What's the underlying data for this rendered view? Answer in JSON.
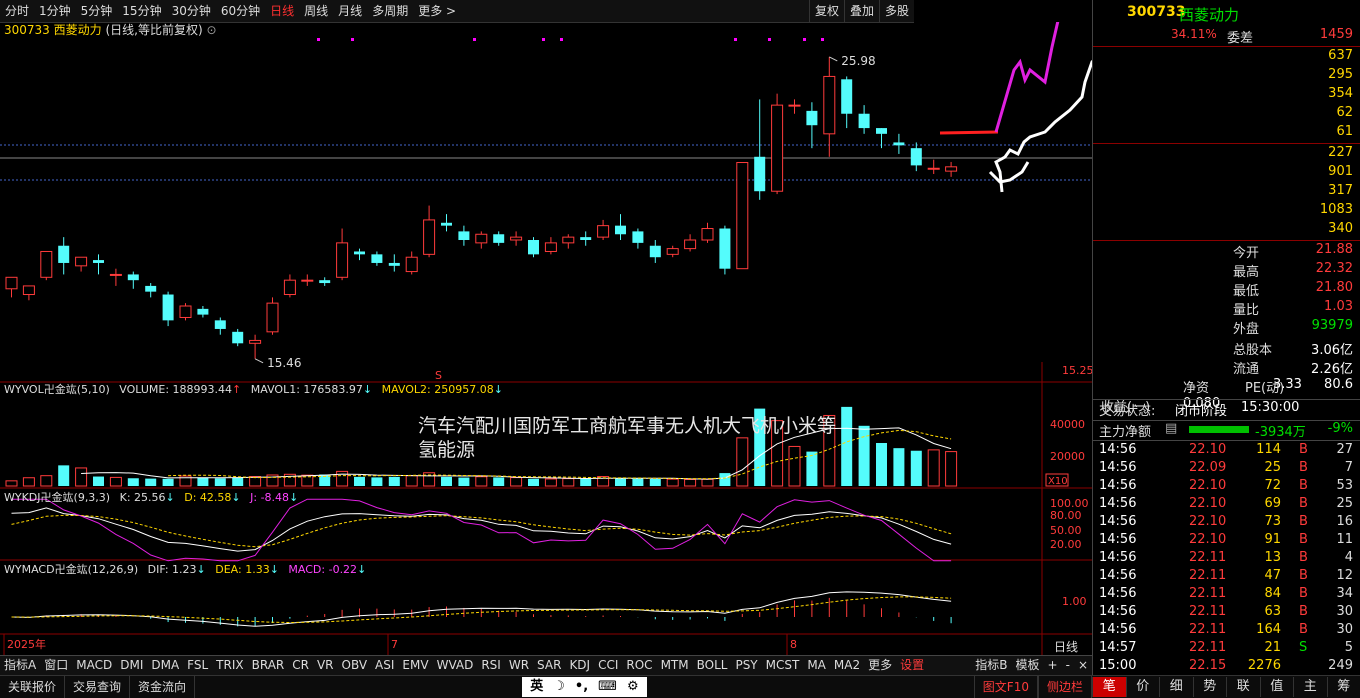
{
  "periods": [
    "分时",
    "1分钟",
    "5分钟",
    "15分钟",
    "30分钟",
    "60分钟",
    "日线",
    "周线",
    "月线",
    "多周期",
    "更多 >"
  ],
  "active_period": "日线",
  "tools": [
    "复权",
    "叠加",
    "多股"
  ],
  "stock": {
    "code": "300733",
    "name": "西菱动力",
    "mode": "(日线,等比前复权)"
  },
  "labels": {
    "high_price": "25.98",
    "low_price": "15.46"
  },
  "price_axis": {
    "top": "15.25"
  },
  "vol_axis": {
    "v1": "40000",
    "v2": "20000",
    "unit": "X10"
  },
  "kdj_axis": {
    "a": "100.00",
    "b": "80.00",
    "c": "50.00",
    "d": "20.00"
  },
  "macd_axis": {
    "a": "1.00"
  },
  "date_labels": [
    "2025年",
    "7",
    "8"
  ],
  "chart_tag": "日线",
  "vol_indicator": {
    "name": "WYVOL卍金竑(5,10)",
    "volume": "VOLUME: 188993.44",
    "mavol1": "MAVOL1: 176583.97",
    "mavol2": "MAVOL2: 250957.08"
  },
  "kdj_indicator": {
    "name": "WYKDJ卍金竑(9,3,3)",
    "k": "K: 25.56",
    "d": "D: 42.58",
    "j": "J: -8.48"
  },
  "macd_indicator": {
    "name": "WYMACD卍金竑(12,26,9)",
    "dif": "DIF: 1.23",
    "dea": "DEA: 1.33",
    "macd": "MACD: -0.22"
  },
  "overlay_text": {
    "line1": "汽车汽配川国防军工商航军事无人机大飞机小米等",
    "line2": "氢能源"
  },
  "indicator_tabs": [
    "指标A",
    "窗口",
    "MACD",
    "DMI",
    "DMA",
    "FSL",
    "TRIX",
    "BRAR",
    "CR",
    "VR",
    "OBV",
    "ASI",
    "EMV",
    "WVAD",
    "RSI",
    "WR",
    "SAR",
    "KDJ",
    "CCI",
    "ROC",
    "MTM",
    "BOLL",
    "PSY",
    "MCST",
    "MA",
    "MA2",
    "更多",
    "设置",
    "指标B",
    "模板",
    "+",
    "-",
    "×"
  ],
  "status_buttons": [
    "关联报价",
    "交易查询",
    "资金流向"
  ],
  "status_icons": [
    "英",
    "☽",
    "•,",
    "⌨",
    "⚙"
  ],
  "status_right": [
    "图文F10",
    "侧边栏"
  ],
  "panel": {
    "header_code": "300733",
    "header_name": "西菱动力",
    "wb_label": "委差",
    "wb_ratio": "34.11%",
    "wb_value": "1459",
    "book": [
      "637",
      "295",
      "354",
      "62",
      "61",
      "227",
      "901",
      "317",
      "1083",
      "340"
    ],
    "stats": [
      {
        "k": "今开",
        "v": "21.88"
      },
      {
        "k": "最高",
        "v": "22.32"
      },
      {
        "k": "最低",
        "v": "21.80"
      },
      {
        "k": "量比",
        "v": "1.03"
      },
      {
        "k": "外盘",
        "v": "93979"
      },
      {
        "k": "总股本",
        "v": "3.06亿"
      },
      {
        "k": "流通",
        "v": "2.26亿"
      },
      {
        "k": "净资",
        "v": "3.33"
      },
      {
        "k": "收益(一)",
        "v": "0.080"
      },
      {
        "k": "PE(动)",
        "v": "80.6"
      }
    ],
    "trade_state_label": "交易状态:",
    "trade_state": "闭市阶段",
    "trade_time": "15:30:00",
    "main_flow_label": "主力净额",
    "main_flow": "-3934万",
    "main_flow_pct": "-9%",
    "ticks": [
      {
        "t": "14:56",
        "p": "22.10",
        "v": "114",
        "d": "B",
        "n": "27"
      },
      {
        "t": "14:56",
        "p": "22.09",
        "v": "25",
        "d": "B",
        "n": "7"
      },
      {
        "t": "14:56",
        "p": "22.10",
        "v": "72",
        "d": "B",
        "n": "53"
      },
      {
        "t": "14:56",
        "p": "22.10",
        "v": "69",
        "d": "B",
        "n": "25"
      },
      {
        "t": "14:56",
        "p": "22.10",
        "v": "73",
        "d": "B",
        "n": "16"
      },
      {
        "t": "14:56",
        "p": "22.10",
        "v": "91",
        "d": "B",
        "n": "11"
      },
      {
        "t": "14:56",
        "p": "22.11",
        "v": "13",
        "d": "B",
        "n": "4"
      },
      {
        "t": "14:56",
        "p": "22.11",
        "v": "47",
        "d": "B",
        "n": "12"
      },
      {
        "t": "14:56",
        "p": "22.11",
        "v": "84",
        "d": "B",
        "n": "34"
      },
      {
        "t": "14:56",
        "p": "22.11",
        "v": "63",
        "d": "B",
        "n": "30"
      },
      {
        "t": "14:56",
        "p": "22.11",
        "v": "164",
        "d": "B",
        "n": "30"
      },
      {
        "t": "14:57",
        "p": "22.11",
        "v": "21",
        "d": "S",
        "n": "5"
      },
      {
        "t": "15:00",
        "p": "22.15",
        "v": "2276",
        "d": "",
        "n": "249"
      }
    ],
    "tabs": [
      "笔",
      "价",
      "细",
      "势",
      "联",
      "值",
      "主",
      "筹"
    ],
    "active_tab": "笔"
  },
  "chart_data": {
    "type": "candlestick",
    "candles": [
      [
        17.9,
        18.3,
        17.6,
        18.1
      ],
      [
        17.7,
        18.0,
        17.5,
        18.0
      ],
      [
        18.3,
        19.2,
        18.2,
        19.1
      ],
      [
        19.4,
        18.8,
        18.4,
        19.7
      ],
      [
        18.7,
        19.0,
        18.5,
        18.9
      ],
      [
        18.9,
        18.8,
        18.4,
        19.1
      ],
      [
        18.4,
        18.4,
        18.0,
        18.6
      ],
      [
        18.4,
        18.2,
        17.9,
        18.5
      ],
      [
        18.0,
        17.8,
        17.6,
        18.1
      ],
      [
        17.7,
        16.8,
        16.6,
        17.8
      ],
      [
        16.9,
        17.3,
        16.8,
        17.4
      ],
      [
        17.2,
        17.0,
        16.9,
        17.3
      ],
      [
        16.8,
        16.5,
        16.3,
        16.9
      ],
      [
        16.4,
        16.0,
        15.9,
        16.5
      ],
      [
        16.0,
        16.1,
        15.46,
        16.3
      ],
      [
        16.4,
        17.4,
        16.3,
        17.6
      ],
      [
        17.7,
        18.2,
        17.6,
        18.4
      ],
      [
        18.2,
        18.2,
        18.0,
        18.4
      ],
      [
        18.2,
        18.1,
        18.0,
        18.3
      ],
      [
        18.3,
        19.5,
        18.2,
        20.0
      ],
      [
        19.2,
        19.1,
        18.9,
        19.3
      ],
      [
        19.1,
        18.8,
        18.7,
        19.2
      ],
      [
        18.8,
        18.7,
        18.5,
        19.1
      ],
      [
        18.5,
        19.0,
        18.4,
        19.2
      ],
      [
        19.1,
        20.3,
        19.0,
        20.8
      ],
      [
        20.2,
        20.1,
        19.9,
        20.5
      ],
      [
        19.9,
        19.6,
        19.4,
        20.1
      ],
      [
        19.5,
        19.8,
        19.3,
        19.9
      ],
      [
        19.8,
        19.5,
        19.4,
        19.9
      ],
      [
        19.6,
        19.7,
        19.4,
        19.9
      ],
      [
        19.6,
        19.1,
        19.0,
        19.7
      ],
      [
        19.2,
        19.5,
        19.1,
        19.7
      ],
      [
        19.5,
        19.7,
        19.3,
        19.8
      ],
      [
        19.7,
        19.6,
        19.4,
        19.9
      ],
      [
        19.7,
        20.1,
        19.6,
        20.3
      ],
      [
        20.1,
        19.8,
        19.6,
        20.5
      ],
      [
        19.9,
        19.5,
        19.3,
        20.0
      ],
      [
        19.4,
        19.0,
        18.8,
        19.6
      ],
      [
        19.1,
        19.3,
        19.0,
        19.4
      ],
      [
        19.3,
        19.6,
        19.2,
        19.8
      ],
      [
        19.6,
        20.0,
        19.5,
        20.2
      ],
      [
        20.0,
        18.6,
        18.4,
        20.1
      ],
      [
        18.6,
        22.3,
        18.6,
        22.3
      ],
      [
        22.5,
        21.3,
        21.0,
        24.5
      ],
      [
        21.3,
        24.3,
        21.2,
        24.7
      ],
      [
        24.3,
        24.3,
        24.0,
        24.5
      ],
      [
        24.1,
        23.6,
        22.8,
        24.4
      ],
      [
        23.3,
        25.3,
        22.5,
        25.98
      ],
      [
        25.2,
        24.0,
        23.5,
        25.3
      ],
      [
        24.0,
        23.5,
        23.3,
        24.3
      ],
      [
        23.5,
        23.3,
        22.8,
        23.5
      ],
      [
        23.0,
        22.9,
        22.6,
        23.3
      ],
      [
        22.8,
        22.2,
        22.0,
        23.0
      ],
      [
        22.1,
        22.1,
        21.9,
        22.4
      ],
      [
        22.0,
        22.15,
        21.8,
        22.32
      ]
    ],
    "volumes": [
      3000,
      4800,
      6000,
      12000,
      10500,
      5500,
      5000,
      4500,
      4300,
      4200,
      5800,
      5000,
      4500,
      4800,
      5500,
      6400,
      6800,
      6300,
      6700,
      8500,
      5300,
      5000,
      5300,
      6000,
      7700,
      5300,
      4900,
      5400,
      5000,
      4900,
      4200,
      4100,
      4300,
      4200,
      5500,
      4500,
      4300,
      4100,
      4000,
      3800,
      3900,
      7500,
      28000,
      45000,
      38000,
      23000,
      20000,
      41000,
      46000,
      35000,
      25000,
      22000,
      20500,
      21000,
      20000
    ],
    "y_range": [
      15.0,
      26.5
    ]
  }
}
